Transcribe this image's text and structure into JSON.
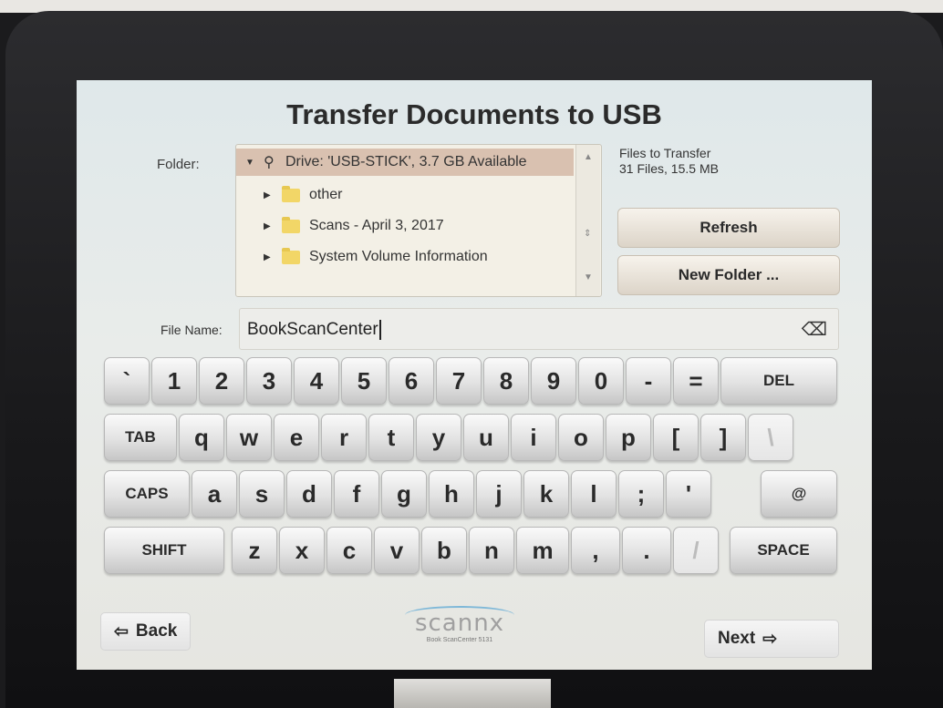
{
  "title": "Transfer Documents to USB",
  "folder": {
    "label": "Folder:",
    "drive_label": "Drive: 'USB-STICK', 3.7 GB Available",
    "folders": [
      "other",
      "Scans - April 3, 2017",
      "System Volume Information"
    ]
  },
  "files_to_transfer": {
    "label": "Files to Transfer",
    "value": "31 Files, 15.5 MB"
  },
  "buttons": {
    "refresh": "Refresh",
    "new_folder": "New Folder ..."
  },
  "file_name": {
    "label": "File Name:",
    "value": "BookScanCenter"
  },
  "keyboard": {
    "row1": [
      "`",
      "1",
      "2",
      "3",
      "4",
      "5",
      "6",
      "7",
      "8",
      "9",
      "0",
      "-",
      "=",
      "DEL"
    ],
    "row2": [
      "TAB",
      "q",
      "w",
      "e",
      "r",
      "t",
      "y",
      "u",
      "i",
      "o",
      "p",
      "[",
      "]",
      "\\"
    ],
    "row3": [
      "CAPS",
      "a",
      "s",
      "d",
      "f",
      "g",
      "h",
      "j",
      "k",
      "l",
      ";",
      "'",
      "@"
    ],
    "row4": [
      "SHIFT",
      "z",
      "x",
      "c",
      "v",
      "b",
      "n",
      "m",
      ",",
      ".",
      "/",
      "SPACE"
    ]
  },
  "nav": {
    "back": "Back",
    "next": "Next"
  },
  "logo": {
    "name": "scannx",
    "product": "Book ScanCenter 5131"
  },
  "colors": {
    "selected_row": "#d9c1b0",
    "folder_icon": "#f2d667",
    "screen_bg": "#e3e8e6"
  }
}
